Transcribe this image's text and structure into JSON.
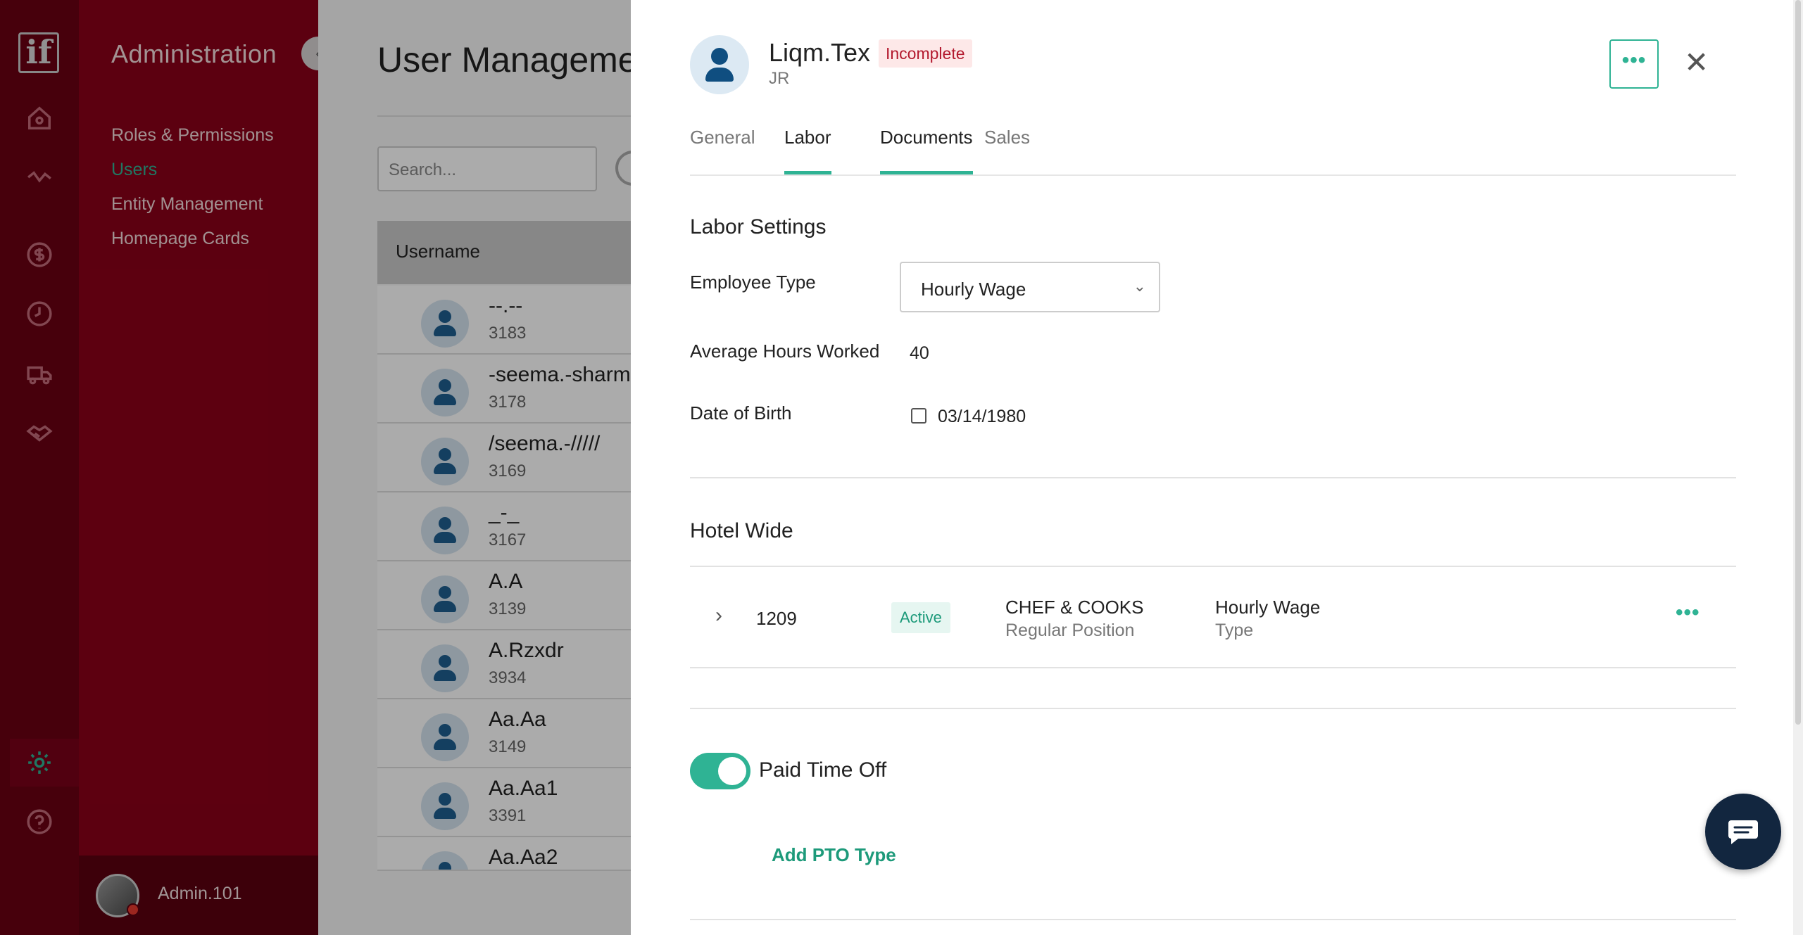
{
  "rail": {
    "logo_text": "if",
    "icons": [
      "logo-icon",
      "home-icon",
      "activity-icon",
      "dollar-icon",
      "clock-icon",
      "truck-icon",
      "handshake-icon",
      "gear-icon",
      "help-icon"
    ]
  },
  "admin": {
    "title": "Administration",
    "nav": [
      "Roles & Permissions",
      "Users",
      "Entity Management",
      "Homepage Cards"
    ],
    "active_nav": "Users",
    "user": "Admin.101"
  },
  "main": {
    "title": "User Management",
    "search_placeholder": "Search...",
    "column_username": "Username",
    "rows": [
      {
        "name": "--.--",
        "id": "3183"
      },
      {
        "name": "-seema.-sharma",
        "id": "3178"
      },
      {
        "name": "/seema.-/////",
        "id": "3169"
      },
      {
        "name": "_-_",
        "id": "3167"
      },
      {
        "name": "A.A",
        "id": "3139"
      },
      {
        "name": "A.Rzxdr",
        "id": "3934"
      },
      {
        "name": "Aa.Aa",
        "id": "3149"
      },
      {
        "name": "Aa.Aa1",
        "id": "3391"
      },
      {
        "name": "Aa.Aa2",
        "id": ""
      }
    ]
  },
  "drawer": {
    "name": "Liqm.Tex",
    "status_badge": "Incomplete",
    "subtitle": "JR",
    "more_label": "•••",
    "close_label": "✕",
    "tabs": [
      "General",
      "Labor",
      "Documents",
      "Sales"
    ],
    "labor_settings": {
      "title": "Labor Settings",
      "employee_type_label": "Employee Type",
      "employee_type_value": "Hourly Wage",
      "avg_hours_label": "Average Hours Worked",
      "avg_hours_value": "40",
      "dob_label": "Date of Birth",
      "dob_value": "03/14/1980"
    },
    "hotel_wide": {
      "title": "Hotel Wide",
      "position": {
        "number": "1209",
        "status": "Active",
        "title": "CHEF & COOKS",
        "title_sub": "Regular Position",
        "type": "Hourly Wage",
        "type_sub": "Type"
      }
    },
    "pto": {
      "label": "Paid Time Off",
      "enabled": true,
      "add_label": "Add PTO Type"
    }
  },
  "colors": {
    "rail_bg": "#6a0012",
    "admin_bg": "#8a0018",
    "accent": "#2fb394",
    "badge_red": "#b3192e"
  }
}
